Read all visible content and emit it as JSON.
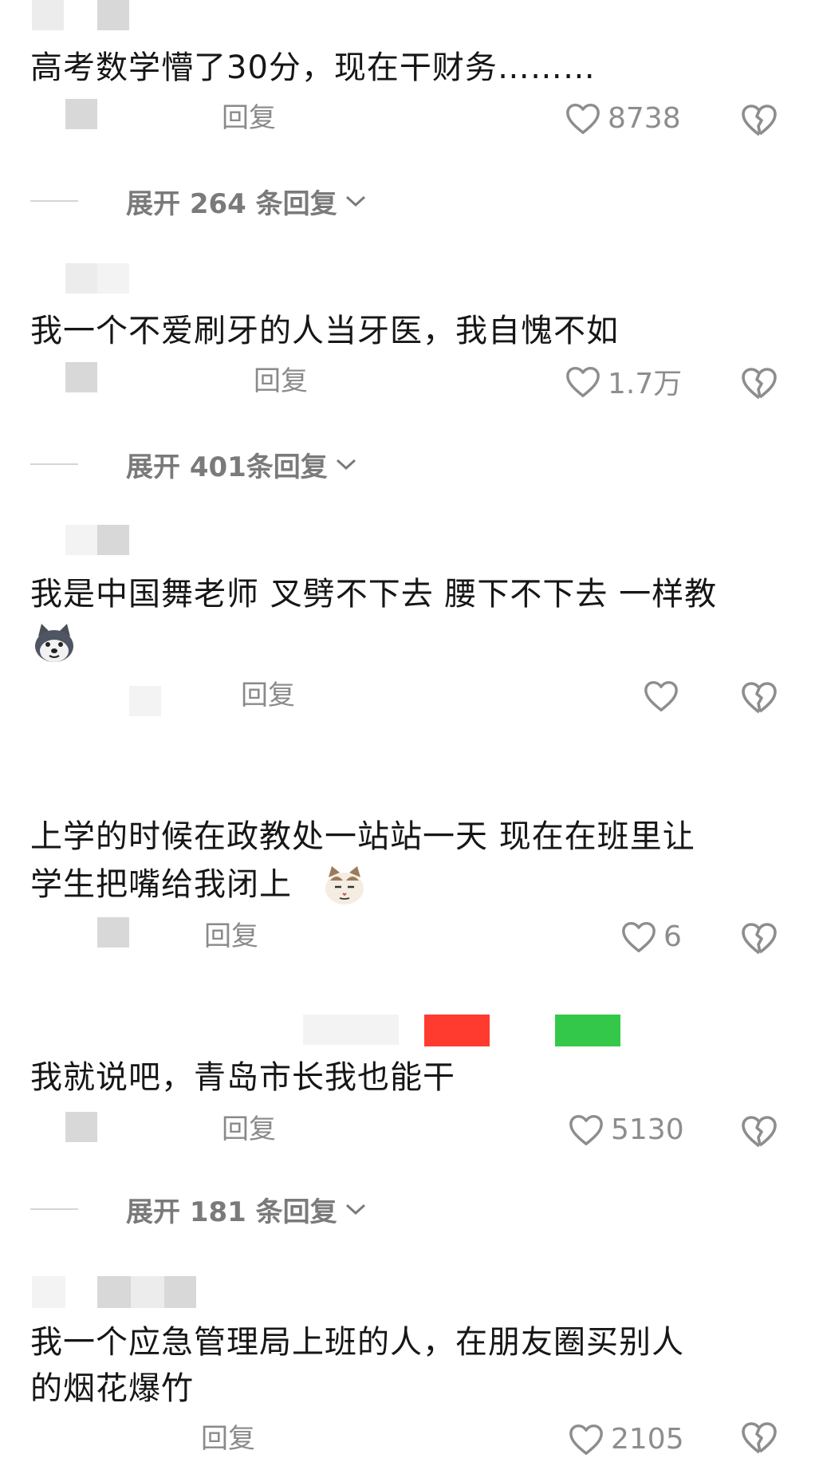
{
  "colors": {
    "icon_gray": "#8d8d8d",
    "text_gray": "#8a8a8a",
    "badge_red": "#ff3b30",
    "badge_green": "#34c84a"
  },
  "comments": [
    {
      "text": "高考数学懵了30分，现在干财务………",
      "reply": "回复",
      "likes": "8738",
      "expand": "展开 264 条回复"
    },
    {
      "text": "我一个不爱刷牙的人当牙医，我自愧不如",
      "reply": "回复",
      "likes": "1.7万",
      "expand": "展开 401条回复"
    },
    {
      "text": "我是中国舞老师 叉劈不下去 腰下不下去 一样教",
      "reply": "回复",
      "likes": "",
      "emoji": "husky-emoji"
    },
    {
      "text_line1": "上学的时候在政教处一站站一天 现在在班里让",
      "text_line2": "学生把嘴给我闭上",
      "reply": "回复",
      "likes": "6",
      "emoji": "cat-emoji"
    },
    {
      "text": "我就说吧，青岛市长我也能干",
      "reply": "回复",
      "likes": "5130",
      "expand": "展开 181 条回复"
    },
    {
      "text_line1": "我一个应急管理局上班的人，在朋友圈买别人",
      "text_line2": "的烟花爆竹",
      "reply": "回复",
      "likes": "2105"
    }
  ]
}
